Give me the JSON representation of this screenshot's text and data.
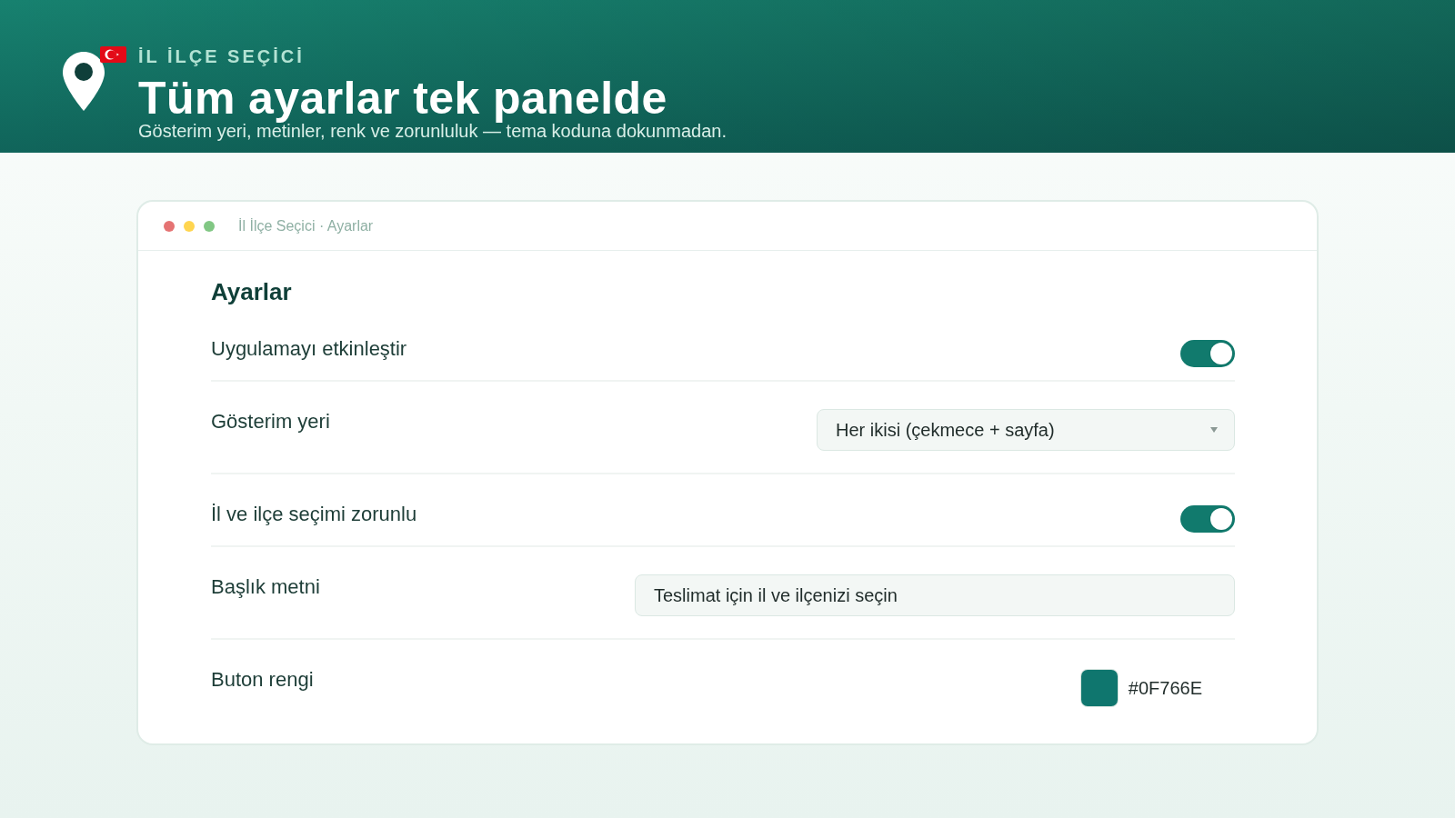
{
  "header": {
    "eyebrow": "İL İLÇE SEÇİCİ",
    "title": "Tüm ayarlar tek panelde",
    "subtitle": "Gösterim yeri, metinler, renk ve zorunluluk — tema koduna dokunmadan."
  },
  "window": {
    "title": "İl İlçe Seçici · Ayarlar"
  },
  "settings": {
    "heading": "Ayarlar",
    "rows": [
      {
        "kind": "toggle",
        "label": "Uygulamayı etkinleştir",
        "on": true
      },
      {
        "kind": "select",
        "label": "Gösterim yeri",
        "value": "Her ikisi (çekmece + sayfa)"
      },
      {
        "kind": "toggle",
        "label": "İl ve ilçe seçimi zorunlu",
        "on": true
      },
      {
        "kind": "text",
        "label": "Başlık metni",
        "value": "Teslimat için il ve ilçenizi seçin"
      },
      {
        "kind": "color",
        "label": "Buton rengi",
        "color": "#0f766e",
        "value": "#0F766E"
      }
    ]
  }
}
